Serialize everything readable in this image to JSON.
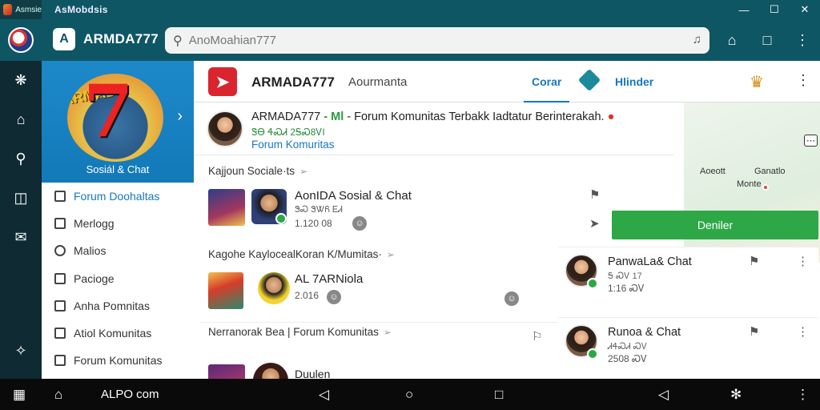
{
  "titlebar": {
    "app_label": "Asmsie",
    "title": "AsMobdsis",
    "minimize": "—",
    "maximize": "☐",
    "close": "✕"
  },
  "topbar": {
    "brand_name": "ARMDA777",
    "search_placeholder": "AnoMoahian777"
  },
  "hero": {
    "caption": "Sosiál & Chat",
    "banner_text": "ARMADA",
    "banner_number": "7"
  },
  "sidebar": {
    "items": [
      {
        "label": "Forum Doohaltas"
      },
      {
        "label": "Merlogg"
      },
      {
        "label": "Malios"
      },
      {
        "label": "Pacioge"
      },
      {
        "label": "Anha Pomnitas"
      },
      {
        "label": "Atiol Komunitas"
      },
      {
        "label": "Forum Komunitas"
      }
    ]
  },
  "tabs": {
    "brand": "ARMADA777",
    "subtitle": "Aourmanta",
    "tab_active": "Corar",
    "tab_second": "Hlinder"
  },
  "post": {
    "title_main": "ARMADA777",
    "title_check": "- Ml",
    "title_rest": "- Forum Komunitas Terbakk Iadtatur Berinterakah.",
    "sub": "ᏕᎾ ᏎᏍᏗ 2ᎦᏍ8ᏙI",
    "link": "Forum Komuritas"
  },
  "map": {
    "label_a": "Aoeott",
    "label_b": "Ganatlo",
    "label_c": "Monte"
  },
  "cards": [
    {
      "header": "Kajjoun Sociale·ts",
      "name": "AonIDA Sosial & Chat",
      "meta1": "ᏕᏍ ᏕᏔᏲ ᎬᏗ",
      "meta2": "1.120 08"
    },
    {
      "header": "Kagohe KaylocealKoran K/Mumitas·",
      "name": "AL 7ARNiola",
      "meta1": "2.016"
    },
    {
      "header": "Nerranorak Bea | Forum Komunitas",
      "name": "Duulen"
    }
  ],
  "right_cards": [
    {
      "name": "PanwaLa& Chat",
      "meta1": "Ꭶ ᏍᏙ 17",
      "meta2": "1:16 ᏍᏙ"
    },
    {
      "name": "Runoa & Chat",
      "meta1": "ᏗᏎᏍᏗ ᏍᏙ",
      "meta2": "2508 ᏍᏙ"
    }
  ],
  "green_button": "Deniler",
  "navbar": {
    "center_text": "ALPO com"
  }
}
